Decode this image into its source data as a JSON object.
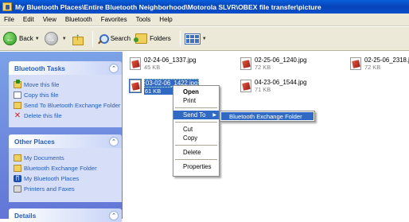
{
  "window": {
    "title": "My Bluetooth Places\\Entire Bluetooth Neighborhood\\Motorola SLVR\\OBEX file transfer\\picture"
  },
  "menu": [
    "File",
    "Edit",
    "View",
    "Bluetooth",
    "Favorites",
    "Tools",
    "Help"
  ],
  "toolbar": {
    "back_label": "Back",
    "search_label": "Search",
    "folders_label": "Folders"
  },
  "tasks_panel": {
    "title": "Bluetooth Tasks",
    "items": [
      "Move this file",
      "Copy this file",
      "Send To Bluetooth Exchange Folder",
      "Delete this file"
    ]
  },
  "other_places": {
    "title": "Other Places",
    "items": [
      "My Documents",
      "Bluetooth Exchange Folder",
      "My Bluetooth Places",
      "Printers and Faxes"
    ]
  },
  "details_panel": {
    "title": "Details"
  },
  "files": [
    {
      "name": "02-24-06_1337.jpg",
      "size": "45 KB"
    },
    {
      "name": "02-25-06_1240.jpg",
      "size": "72 KB"
    },
    {
      "name": "02-25-06_2318.jpg",
      "size": "72 KB"
    },
    {
      "name": "03-02-06_1422.jpg",
      "size": "61 KB",
      "selected": true
    },
    {
      "name": "04-23-06_1544.jpg",
      "size": "71 KB"
    }
  ],
  "context_menu": {
    "items": [
      "Open",
      "Print",
      "Send To",
      "Cut",
      "Copy",
      "Delete",
      "Properties"
    ],
    "submenu_item": "Bluetooth Exchange Folder"
  },
  "colors": {
    "titlebar": "#0a4fcc",
    "selection": "#316ac5",
    "task_link": "#215dc6",
    "pane_bg": "#6f8fe0"
  }
}
